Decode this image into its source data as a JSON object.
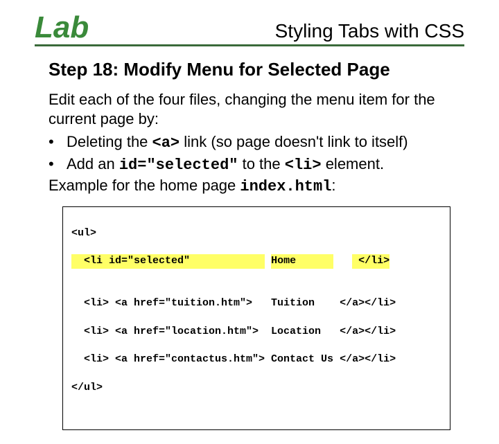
{
  "header": {
    "lab": "Lab",
    "title": "Styling Tabs with CSS"
  },
  "step_heading": "Step 18:  Modify Menu for Selected Page",
  "intro": "Edit each of the four files, changing the menu item for the current page by:",
  "bullets": [
    {
      "pre": "Deleting the ",
      "code": "<a>",
      "post": " link (so page doesn't link to itself)"
    },
    {
      "pre": "Add an ",
      "code": "id=\"selected\"",
      "post_pre": " to the ",
      "code2": "<li>",
      "post": "  element."
    }
  ],
  "example": {
    "pre": "Example for the home page ",
    "code": "index.html",
    "post": ":"
  },
  "code": {
    "l1": "<ul>",
    "l2a": "  <li id=\"selected\"            ",
    "l2b": "Home      ",
    "l2c": " </li>",
    "blank": "",
    "l3": "  <li> <a href=\"tuition.htm\">   Tuition    </a></li>",
    "l4": "  <li> <a href=\"location.htm\">  Location   </a></li>",
    "l5": "  <li> <a href=\"contactus.htm\"> Contact Us </a></li>",
    "l6": "</ul>"
  }
}
